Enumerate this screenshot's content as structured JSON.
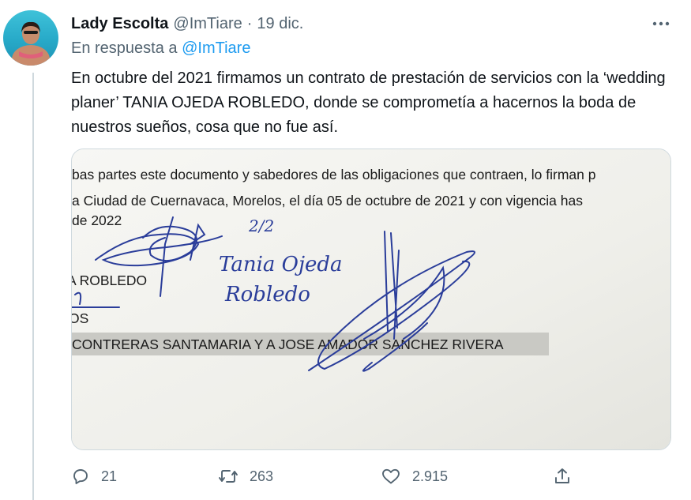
{
  "tweet": {
    "author_name": "Lady Escolta",
    "author_handle": "@ImTiare",
    "separator": "·",
    "date": "19 dic.",
    "reply_prefix": "En respuesta a",
    "reply_mention": "@ImTiare",
    "text": "En octubre del 2021 firmamos un contrato de prestación de servicios con la ‘wedding planer’ TANIA OJEDA ROBLEDO, donde se comprometía a hacernos la boda de nuestros sueños, cosa que no fue así."
  },
  "media": {
    "doc_lines": [
      "bas partes este documento y sabedores de las obligaciones que contraen, lo firman p",
      "a Ciudad de Cuernavaca, Morelos, el día  05 de octubre de  2021 y con vigencia has",
      "de 2022"
    ],
    "name_fragment": "A ROBLEDO",
    "os_fragment": "OS",
    "highlighted_line": "CONTRERAS SANTAMARIA Y A JOSE AMADOR SANCHEZ RIVERA",
    "handwritten_page": "2/2",
    "handwritten_name_1": "Tania Ojeda",
    "handwritten_name_2": "Robledo"
  },
  "actions": {
    "replies": "21",
    "retweets": "263",
    "likes": "2.915"
  },
  "colors": {
    "accent": "#1d9bf0",
    "text": "#0f1419",
    "secondary": "#536471",
    "border": "#cfd9de",
    "ink": "#2a3d9a"
  },
  "icons": [
    "more-icon",
    "reply-icon",
    "retweet-icon",
    "like-icon",
    "share-icon"
  ]
}
